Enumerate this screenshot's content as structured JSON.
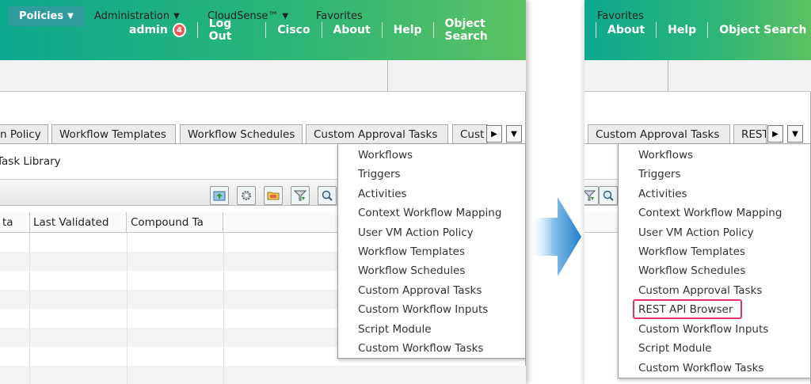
{
  "header": {
    "user": "admin",
    "badge_count": "4",
    "links": [
      "Log Out",
      "Cisco",
      "About",
      "Help",
      "Object Search"
    ]
  },
  "nav": {
    "items": [
      "Policies",
      "Administration",
      "CloudSense™",
      "Favorites"
    ]
  },
  "tabs": {
    "left": [
      "n Policy",
      "Workflow Templates",
      "Workflow Schedules",
      "Custom Approval Tasks",
      "Cust"
    ],
    "right": [
      "Custom Approval Tasks",
      "REST"
    ]
  },
  "breadcrumb": "Task Library",
  "table": {
    "columns": [
      "ta",
      "Last Validated",
      "Compound Ta"
    ]
  },
  "menu_before": [
    "Workflows",
    "Triggers",
    "Activities",
    "Context Workflow Mapping",
    "User VM Action Policy",
    "Workflow Templates",
    "Workflow Schedules",
    "Custom Approval Tasks",
    "Custom Workflow Inputs",
    "Script Module",
    "Custom Workflow Tasks"
  ],
  "menu_after": [
    "Workflows",
    "Triggers",
    "Activities",
    "Context Workflow Mapping",
    "User VM Action Policy",
    "Workflow Templates",
    "Workflow Schedules",
    "Custom Approval Tasks",
    "REST API Browser",
    "Custom Workflow Inputs",
    "Script Module",
    "Custom Workflow Tasks"
  ],
  "colors": {
    "header_start": "#0da98e",
    "header_end": "#5cc162",
    "active_nav": "#2f9c9e",
    "highlight": "#e0336e",
    "arrow": "#1f7fc9"
  },
  "icons": [
    "export-icon",
    "gear-icon",
    "folder-icon",
    "filter-icon",
    "search-icon",
    "triangle-down-icon",
    "triangle-right-icon"
  ]
}
